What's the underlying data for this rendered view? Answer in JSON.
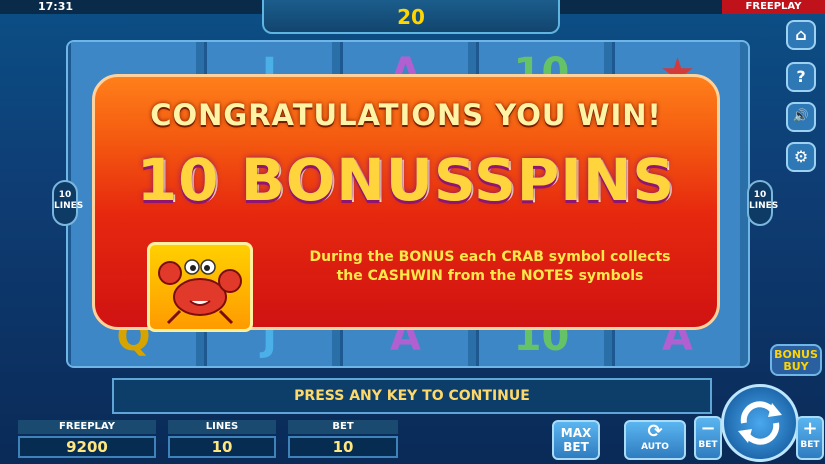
{
  "status_bar": {
    "clock": "17:31",
    "mode_tag": "FREEPLAY"
  },
  "spin_counter": "20",
  "reels": {
    "top_row": [
      "",
      "J",
      "A",
      "10",
      ""
    ],
    "bottom_row": [
      "Q",
      "J",
      "A",
      "10",
      "A"
    ]
  },
  "lines_badge": {
    "left": "10\nLINES",
    "right": "10\nLINES"
  },
  "side_buttons": [
    "home-icon",
    "help-icon",
    "sound-icon",
    "settings-icon"
  ],
  "side_button_glyphs": {
    "home": "⌂",
    "help": "?",
    "sound": "🔊",
    "settings": "⚙"
  },
  "banner": {
    "congrats": "CONGRATULATIONS YOU WIN!",
    "headline": "10 BONUSSPINS",
    "description": "During the BONUS each CRAB symbol collects the CASHWIN from the NOTES symbols"
  },
  "continue_prompt": "PRESS ANY KEY TO CONTINUE",
  "bottom": {
    "freeplay": {
      "label": "FREEPLAY",
      "value": "9200"
    },
    "lines": {
      "label": "LINES",
      "value": "10"
    },
    "bet": {
      "label": "BET",
      "value": "10"
    },
    "max_bet_label": "MAX\nBET",
    "auto_label": "AUTO",
    "bet_minus_label": "BET",
    "bet_plus_label": "BET",
    "bonus_buy_label": "BONUS\nBUY"
  },
  "colors": {
    "banner_top": "#ff7f1a",
    "banner_bottom": "#d01212",
    "accent_yellow": "#ffd400"
  }
}
